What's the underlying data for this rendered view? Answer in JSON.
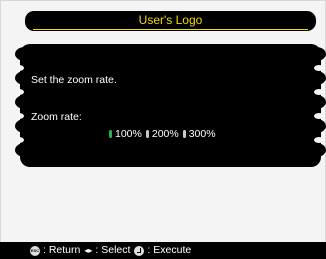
{
  "window": {
    "title": "User's Logo"
  },
  "dialog": {
    "instruction": "Set the zoom rate.",
    "zoom_label": "Zoom rate:",
    "options": [
      {
        "label": "100%",
        "selected": true
      },
      {
        "label": "200%",
        "selected": false
      },
      {
        "label": "300%",
        "selected": false
      }
    ]
  },
  "footer": {
    "return_label": ": Return",
    "select_label": ": Select",
    "execute_label": ": Execute",
    "esc_icon": "esc-button-icon",
    "select_icon": "left-right-arrows-icon",
    "execute_icon": "enter-button-icon"
  },
  "colors": {
    "title_text": "#f5d800",
    "selected_radio": "#2bb24c",
    "unselected_radio": "#c8c8c8",
    "panel": "#000000"
  }
}
